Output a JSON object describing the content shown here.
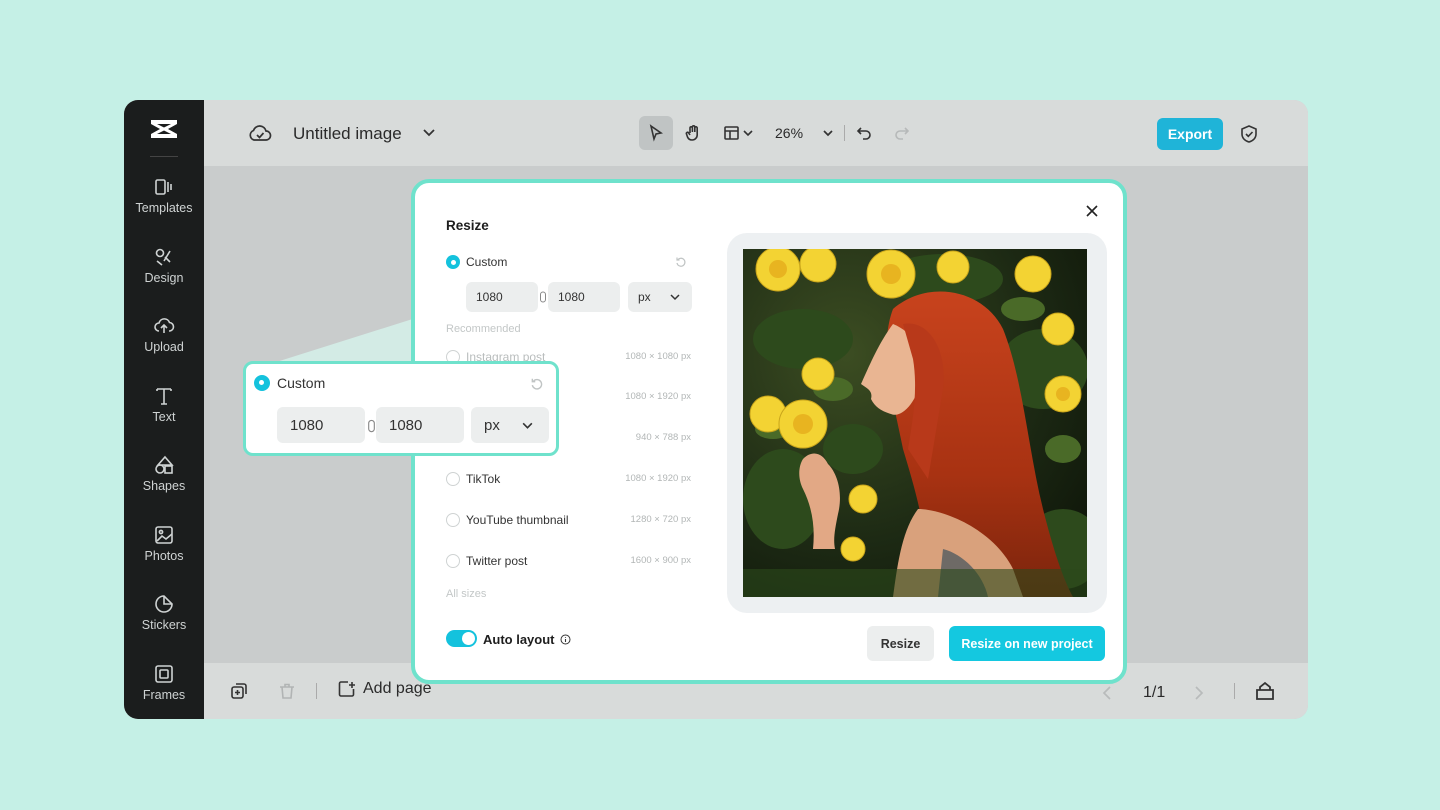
{
  "app": {
    "doc_title": "Untitled image",
    "zoom": "26%",
    "export_label": "Export"
  },
  "sidebar": {
    "items": [
      {
        "label": "Templates",
        "icon": "templates-icon"
      },
      {
        "label": "Design",
        "icon": "design-icon"
      },
      {
        "label": "Upload",
        "icon": "upload-icon"
      },
      {
        "label": "Text",
        "icon": "text-icon"
      },
      {
        "label": "Shapes",
        "icon": "shapes-icon"
      },
      {
        "label": "Photos",
        "icon": "photos-icon"
      },
      {
        "label": "Stickers",
        "icon": "stickers-icon"
      },
      {
        "label": "Frames",
        "icon": "frames-icon"
      }
    ]
  },
  "bottombar": {
    "add_page": "Add page",
    "page_count": "1/1"
  },
  "modal": {
    "title": "Resize",
    "custom": {
      "label": "Custom",
      "width": "1080",
      "height": "1080",
      "unit": "px"
    },
    "recommended_label": "Recommended",
    "options": [
      {
        "label": "Instagram post",
        "size": "1080 × 1080 px"
      },
      {
        "label": "",
        "size": "1080 × 1920 px"
      },
      {
        "label": "",
        "size": "940 × 788 px"
      },
      {
        "label": "TikTok",
        "size": "1080 × 1920 px"
      },
      {
        "label": "YouTube thumbnail",
        "size": "1280 × 720 px"
      },
      {
        "label": "Twitter post",
        "size": "1600 × 900 px"
      }
    ],
    "all_sizes": "All sizes",
    "auto_layout": "Auto layout",
    "auto_layout_on": true,
    "resize_btn": "Resize",
    "resize_new_btn": "Resize on new project"
  },
  "colors": {
    "accent": "#14c2dd",
    "outline": "#6fe2cc",
    "background": "#c5f0e6",
    "sidebar": "#1b1d1d"
  }
}
